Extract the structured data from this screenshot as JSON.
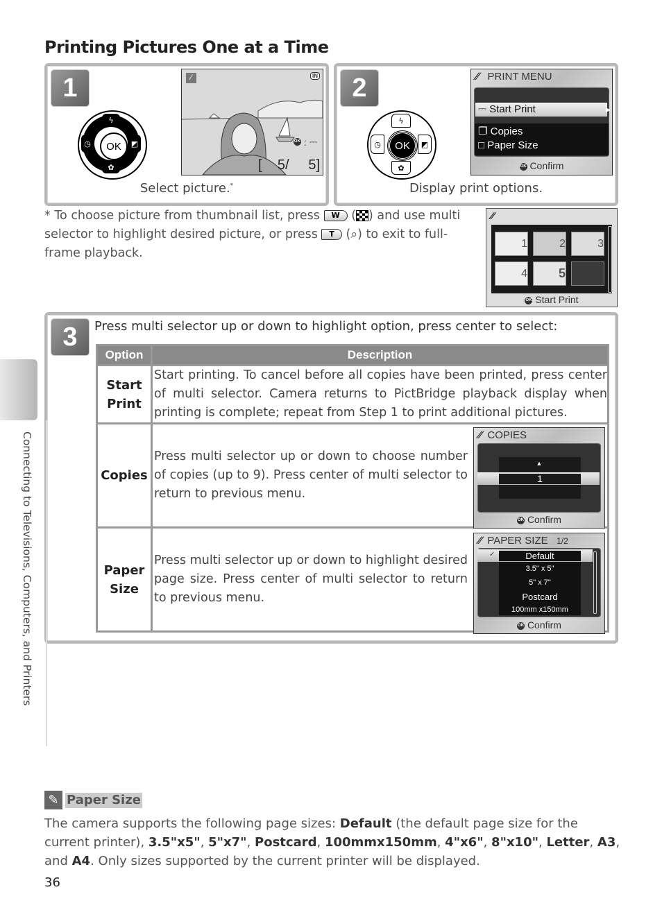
{
  "page": {
    "title": "Printing Pictures One at a Time",
    "page_number": "36",
    "side_tab_label": "Connecting to Televisions, Computers, and Printers"
  },
  "step1": {
    "number": "1",
    "caption": "Select picture.",
    "caption_mark": "*",
    "screen": {
      "mode_icon": "pictbridge-icon",
      "memory_badge": "IN",
      "ok_hint": "OK",
      "ok_action_icon": "print-icon",
      "frame_current": "5/",
      "frame_total": "5"
    },
    "selector": {
      "center": "OK",
      "up": "flash-icon",
      "left": "self-timer-icon",
      "right": "exposure-comp-icon",
      "down": "macro-icon"
    }
  },
  "step2": {
    "number": "2",
    "caption": "Display print options.",
    "menu": {
      "title": "PRINT MENU",
      "items": [
        {
          "label": "Start Print",
          "icon": "print-icon",
          "highlighted": true
        },
        {
          "label": "Copies",
          "icon": "copies-icon",
          "highlighted": false
        },
        {
          "label": "Paper Size",
          "icon": "paper-icon",
          "highlighted": false
        }
      ],
      "confirm": "Confirm"
    },
    "selector": {
      "center": "OK"
    }
  },
  "footnote": {
    "mark": "*",
    "text_a": "To choose picture from thumbnail list, press",
    "key_w": "W",
    "text_b": ") and use multi selector to highlight desired picture, or press",
    "key_t": "T",
    "text_c": ") to exit to full-frame playback.",
    "open_paren": "("
  },
  "thumbnail_screen": {
    "thumbnails": [
      "1",
      "2",
      "3",
      "4",
      "5",
      ""
    ],
    "confirm": "Start Print"
  },
  "step3": {
    "number": "3",
    "instruction": "Press multi selector up or down to highlight option, press center to select:",
    "table": {
      "headers": [
        "Option",
        "Description"
      ],
      "rows": [
        {
          "option": "Start Print",
          "description": "Start printing.  To cancel before all copies have been printed, press center of multi selector.  Camera returns to PictBridge playback display when printing is complete; repeat from Step 1 to print additional pictures."
        },
        {
          "option": "Copies",
          "description": "Press multi selector up or down to choose number of copies (up to 9).  Press center of multi selector to return to previous menu."
        },
        {
          "option": "Paper Size",
          "description": "Press multi selector up or down to highlight desired page size.  Press center of multi selector to return to previous menu."
        }
      ]
    },
    "copies_screen": {
      "title": "COPIES",
      "value": "1",
      "confirm": "Confirm"
    },
    "paper_screen": {
      "title": "PAPER SIZE",
      "page": "1/2",
      "options": [
        "Default",
        "3.5\" x 5\"",
        "5\" x 7\"",
        "Postcard",
        "100mm x150mm"
      ],
      "selected": "Default",
      "confirm": "Confirm"
    }
  },
  "tip": {
    "title": "Paper Size",
    "intro": "The camera supports the following page sizes:",
    "default_label": "Default",
    "default_note": "(the default page size for the current printer),",
    "sizes": [
      "3.5\"x5\"",
      "5\"x7\"",
      "Postcard",
      "100mmx150mm",
      "4\"x6\"",
      "8\"x10\"",
      "Letter",
      "A3"
    ],
    "last_conj": "and",
    "last_size": "A4",
    "outro": "Only sizes supported by the current printer will be displayed."
  }
}
